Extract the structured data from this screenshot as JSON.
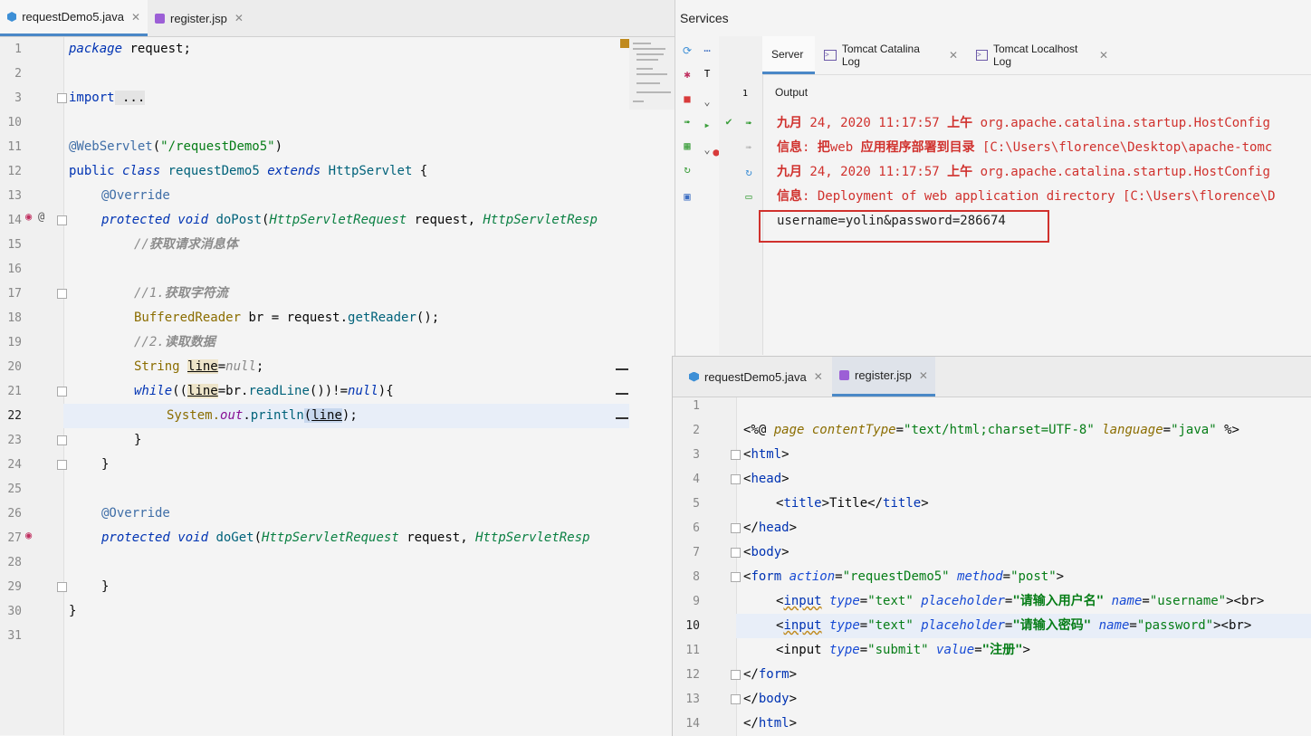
{
  "left_editor": {
    "tabs": [
      {
        "label": "requestDemo5.java",
        "active": true
      },
      {
        "label": "register.jsp",
        "active": false
      }
    ],
    "line_numbers": [
      "1",
      "2",
      "3",
      "10",
      "11",
      "12",
      "13",
      "14",
      "15",
      "16",
      "17",
      "18",
      "19",
      "20",
      "21",
      "22",
      "23",
      "24",
      "25",
      "26",
      "27",
      "28",
      "29",
      "30",
      "31"
    ],
    "current_line": "22",
    "code": {
      "l1_kw": "package",
      "l1_rest": " request;",
      "l3_kw": "import",
      "l3_rest": " ...",
      "l11_ann": "@WebServlet",
      "l11_p1": "(",
      "l11_str": "\"/requestDemo5\"",
      "l11_p2": ")",
      "l12_kw1": "public",
      "l12_kw2": "class",
      "l12_name": "requestDemo5",
      "l12_kw3": "extends",
      "l12_super": "HttpServlet",
      "l12_brace": " {",
      "l13_ann": "@Override",
      "l14_kw1": "protected",
      "l14_kw2": "void",
      "l14_fn": "doPost",
      "l14_type1": "HttpServletRequest",
      "l14_arg1": " request, ",
      "l14_type2": "HttpServletResp",
      "l15_cm1": "//",
      "l15_cm2": "获取请求消息体",
      "l17_cm1": "//1.",
      "l17_cm2": "获取字符流",
      "l18_type": "BufferedReader",
      "l18_rest": " br = request.",
      "l18_fn": "getReader",
      "l18_end": "();",
      "l19_cm1": "//2.",
      "l19_cm2": "读取数据",
      "l20_type": "String",
      "l20_var": "line",
      "l20_eq": "=",
      "l20_null": "null",
      "l20_end": ";",
      "l21_kw": "while",
      "l21_p": "((",
      "l21_var": "line",
      "l21_mid": "=br.",
      "l21_fn": "readLine",
      "l21_cmp": "())!=",
      "l21_null": "null",
      "l21_end": "){",
      "l22_sys": "System.",
      "l22_out": "out",
      "l22_dot": ".",
      "l22_fn": "println",
      "l22_p": "(",
      "l22_var": "line",
      "l22_end": ");",
      "l23": "}",
      "l24": "}",
      "l26_ann": "@Override",
      "l27_kw1": "protected",
      "l27_kw2": "void",
      "l27_fn": "doGet",
      "l27_type1": "HttpServletRequest",
      "l27_arg1": " request, ",
      "l27_type2": "HttpServletResp",
      "l29": "}",
      "l30": "}"
    }
  },
  "services": {
    "title": "Services",
    "tabs": [
      "Server",
      "Tomcat Catalina Log",
      "Tomcat Localhost Log"
    ],
    "output_label": "Output",
    "tree_label": "T",
    "tree_count": "1",
    "log": [
      {
        "date": "九月",
        "day": " 24, 2020 11:17:57 ",
        "ampm": "上午",
        "rest": " org.apache.catalina.startup.HostConfig"
      },
      {
        "label": "信息",
        "sep": ": ",
        "bold": "把",
        "rest1": "web ",
        "bold2": "应用程序部署到目录",
        "rest2": " [C:\\Users\\florence\\Desktop\\apache-tomc"
      },
      {
        "date": "九月",
        "day": " 24, 2020 11:17:57 ",
        "ampm": "上午",
        "rest": " org.apache.catalina.startup.HostConfig"
      },
      {
        "label": "信息",
        "rest": ": Deployment of web application directory [C:\\Users\\florence\\D"
      }
    ],
    "output_result": "username=yolin&password=286674"
  },
  "jsp_editor": {
    "tabs": [
      {
        "label": "requestDemo5.java",
        "active": false
      },
      {
        "label": "register.jsp",
        "active": true
      }
    ],
    "line_numbers": [
      "1",
      "2",
      "3",
      "4",
      "5",
      "6",
      "7",
      "8",
      "9",
      "10",
      "11",
      "12",
      "13",
      "14"
    ],
    "current_line": "10",
    "code": {
      "l2_open": "<%@ ",
      "l2_page": "page",
      "l2_a1": "contentType",
      "l2_eq1": "=",
      "l2_v1": "\"text/html;charset=UTF-8\"",
      "l2_a2": "language",
      "l2_eq2": "=",
      "l2_v2": "\"java\"",
      "l2_close": " %>",
      "l3_lt": "<",
      "l3_tag": "html",
      "l3_gt": ">",
      "l4_lt": "<",
      "l4_tag": "head",
      "l4_gt": ">",
      "l5_lt": "<",
      "l5_tag": "title",
      "l5_mid": ">Title</",
      "l5_tag2": "title",
      "l5_gt": ">",
      "l6_lt": "</",
      "l6_tag": "head",
      "l6_gt": ">",
      "l7_lt": "<",
      "l7_tag": "body",
      "l7_gt": ">",
      "l8_lt": "<",
      "l8_tag": "form",
      "l8_a1": "action",
      "l8_v1": "\"requestDemo5\"",
      "l8_a2": "method",
      "l8_v2": "\"post\"",
      "l8_gt": ">",
      "l9_lt": "<",
      "l9_tag": "input",
      "l9_a1": "type",
      "l9_v1": "\"text\"",
      "l9_a2": "placeholder",
      "l9_v2": "\"请输入用户名\"",
      "l9_a3": "name",
      "l9_v3": "\"username\"",
      "l9_br": "><br>",
      "l10_lt": "<",
      "l10_tag": "input",
      "l10_a1": "type",
      "l10_v1": "\"text\"",
      "l10_a2": "placeholder",
      "l10_v2": "\"请输入密码\"",
      "l10_a3": "name",
      "l10_v3": "\"password\"",
      "l10_br": "><br>",
      "l11_lt": "<input ",
      "l11_a1": "type",
      "l11_v1": "\"submit\"",
      "l11_a2": "value",
      "l11_v2": "\"注册\"",
      "l11_gt": ">",
      "l12_lt": "</",
      "l12_tag": "form",
      "l12_gt": ">",
      "l13_lt": "</",
      "l13_tag": "body",
      "l13_gt": ">",
      "l14_lt": "</",
      "l14_tag": "html",
      "l14_gt": ">"
    }
  },
  "colors": {
    "accent": "#4a88c7",
    "log_red": "#d0312d",
    "keyword": "#0033b3",
    "string": "#067d17"
  }
}
